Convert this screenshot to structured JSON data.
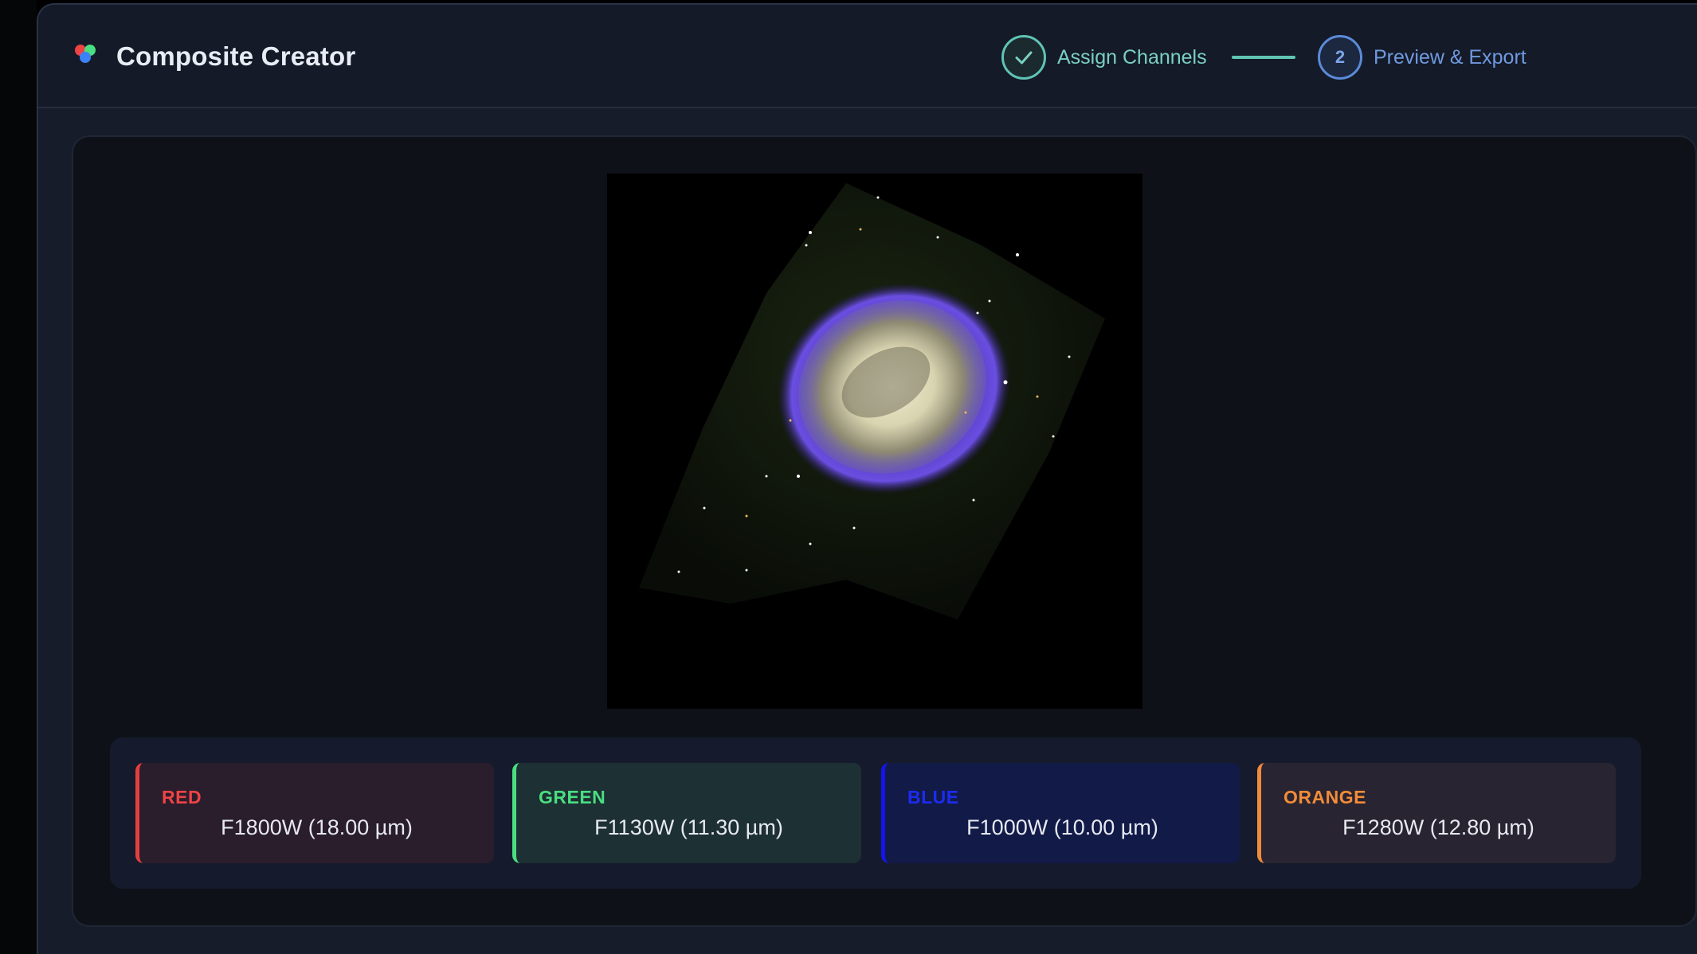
{
  "app": {
    "title": "Composite Creator",
    "logo_icon": "rgb-dots-logo"
  },
  "steps": [
    {
      "number": "1",
      "label": "Assign Channels",
      "status": "complete",
      "icon": "check-icon"
    },
    {
      "number": "2",
      "label": "Preview & Export",
      "status": "current"
    }
  ],
  "preview": {
    "subject": "planetary nebula composite image"
  },
  "channels": [
    {
      "name": "RED",
      "filter": "F1800W (18.00 µm)",
      "color": "#ef4444"
    },
    {
      "name": "GREEN",
      "filter": "F1130W (11.30 µm)",
      "color": "#4ade80"
    },
    {
      "name": "BLUE",
      "filter": "F1000W (10.00 µm)",
      "color": "#1414f0"
    },
    {
      "name": "ORANGE",
      "filter": "F1280W (12.80 µm)",
      "color": "#f28c38"
    }
  ],
  "colors": {
    "background": "#171c2a",
    "workspace": "#0e1117",
    "step_complete": "#5fc4b4",
    "step_current": "#5b8bd8"
  }
}
